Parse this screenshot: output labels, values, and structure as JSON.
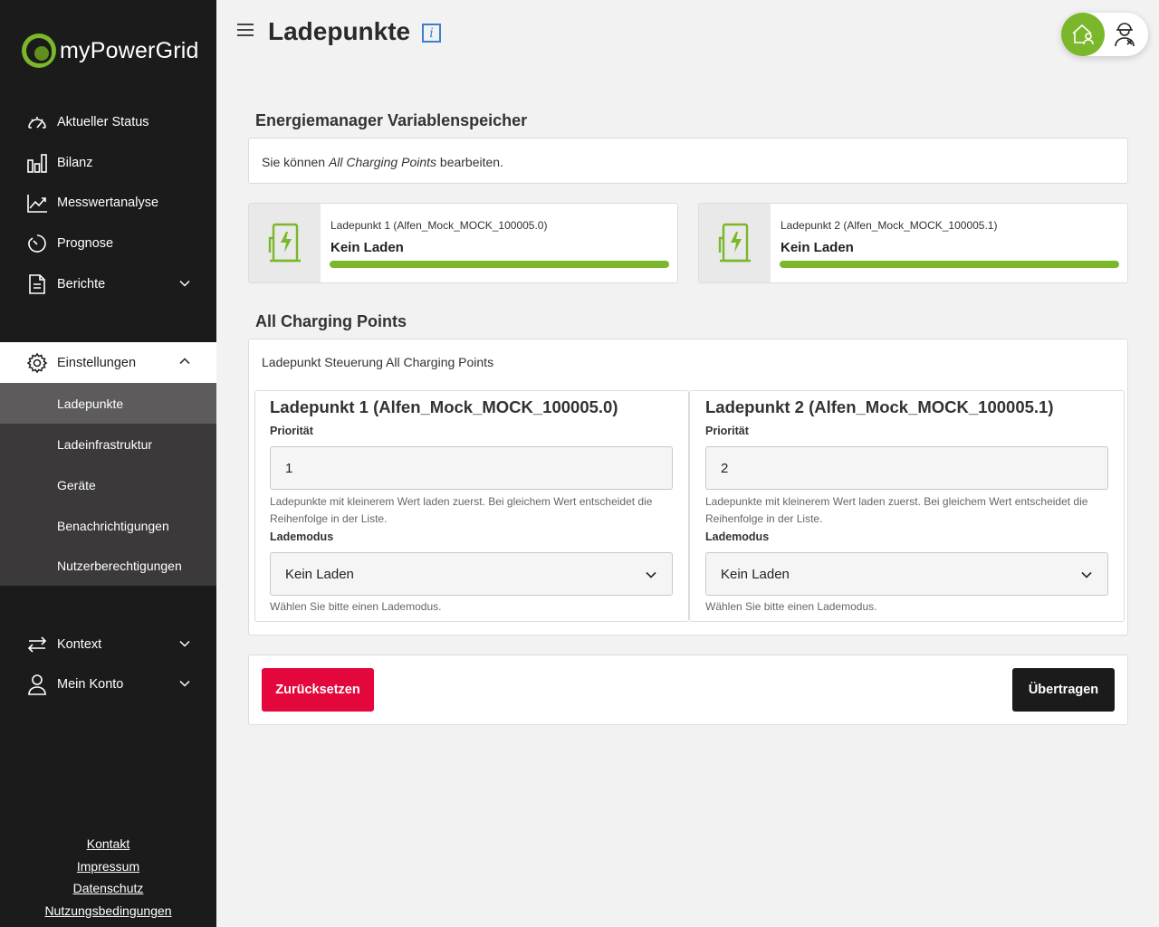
{
  "app": {
    "name": "myPowerGrid"
  },
  "sidebar": {
    "items": [
      {
        "label": "Aktueller Status"
      },
      {
        "label": "Bilanz"
      },
      {
        "label": "Messwertanalyse"
      },
      {
        "label": "Prognose"
      },
      {
        "label": "Berichte"
      },
      {
        "label": "Einstellungen"
      },
      {
        "label": "Kontext"
      },
      {
        "label": "Mein Konto"
      }
    ],
    "sub_items": [
      {
        "label": "Ladepunkte"
      },
      {
        "label": "Ladeinfrastruktur"
      },
      {
        "label": "Geräte"
      },
      {
        "label": "Benachrichtigungen"
      },
      {
        "label": "Nutzerberechtigungen"
      }
    ],
    "footer_links": [
      "Kontakt",
      "Impressum",
      "Datenschutz",
      "Nutzungsbedingungen"
    ]
  },
  "header": {
    "title": "Ladepunkte",
    "info": "i"
  },
  "memory": {
    "title": "Energiemanager Variablenspeicher",
    "notice_prefix": "Sie können ",
    "notice_em": "All Charging Points",
    "notice_suffix": " bearbeiten."
  },
  "status_cards": [
    {
      "name": "Ladepunkt 1 (Alfen_Mock_MOCK_100005.0)",
      "mode": "Kein Laden",
      "progress": 1.0
    },
    {
      "name": "Ladepunkt 2 (Alfen_Mock_MOCK_100005.1)",
      "mode": "Kein Laden",
      "progress": 1.0
    }
  ],
  "control": {
    "title": "All Charging Points",
    "subtitle": "Ladepunkt Steuerung All Charging Points",
    "panels": [
      {
        "heading": "Ladepunkt 1 (Alfen_Mock_MOCK_100005.0)",
        "priority_label": "Priorität",
        "priority_value": "1",
        "priority_help": "Ladepunkte mit kleinerem Wert laden zuerst. Bei gleichem Wert entscheidet die Reihenfolge in der Liste.",
        "mode_label": "Lademodus",
        "mode_value": "Kein Laden",
        "mode_help": "Wählen Sie bitte einen Lademodus."
      },
      {
        "heading": "Ladepunkt 2 (Alfen_Mock_MOCK_100005.1)",
        "priority_label": "Priorität",
        "priority_value": "2",
        "priority_help": "Ladepunkte mit kleinerem Wert laden zuerst. Bei gleichem Wert entscheidet die Reihenfolge in der Liste.",
        "mode_label": "Lademodus",
        "mode_value": "Kein Laden",
        "mode_help": "Wählen Sie bitte einen Lademodus."
      }
    ]
  },
  "actions": {
    "reset_label": "Zurücksetzen",
    "submit_label": "Übertragen"
  },
  "colors": {
    "accent_green": "#7ab72a",
    "reset_red": "#e3073c",
    "sidebar_bg": "#1b1b1b"
  }
}
